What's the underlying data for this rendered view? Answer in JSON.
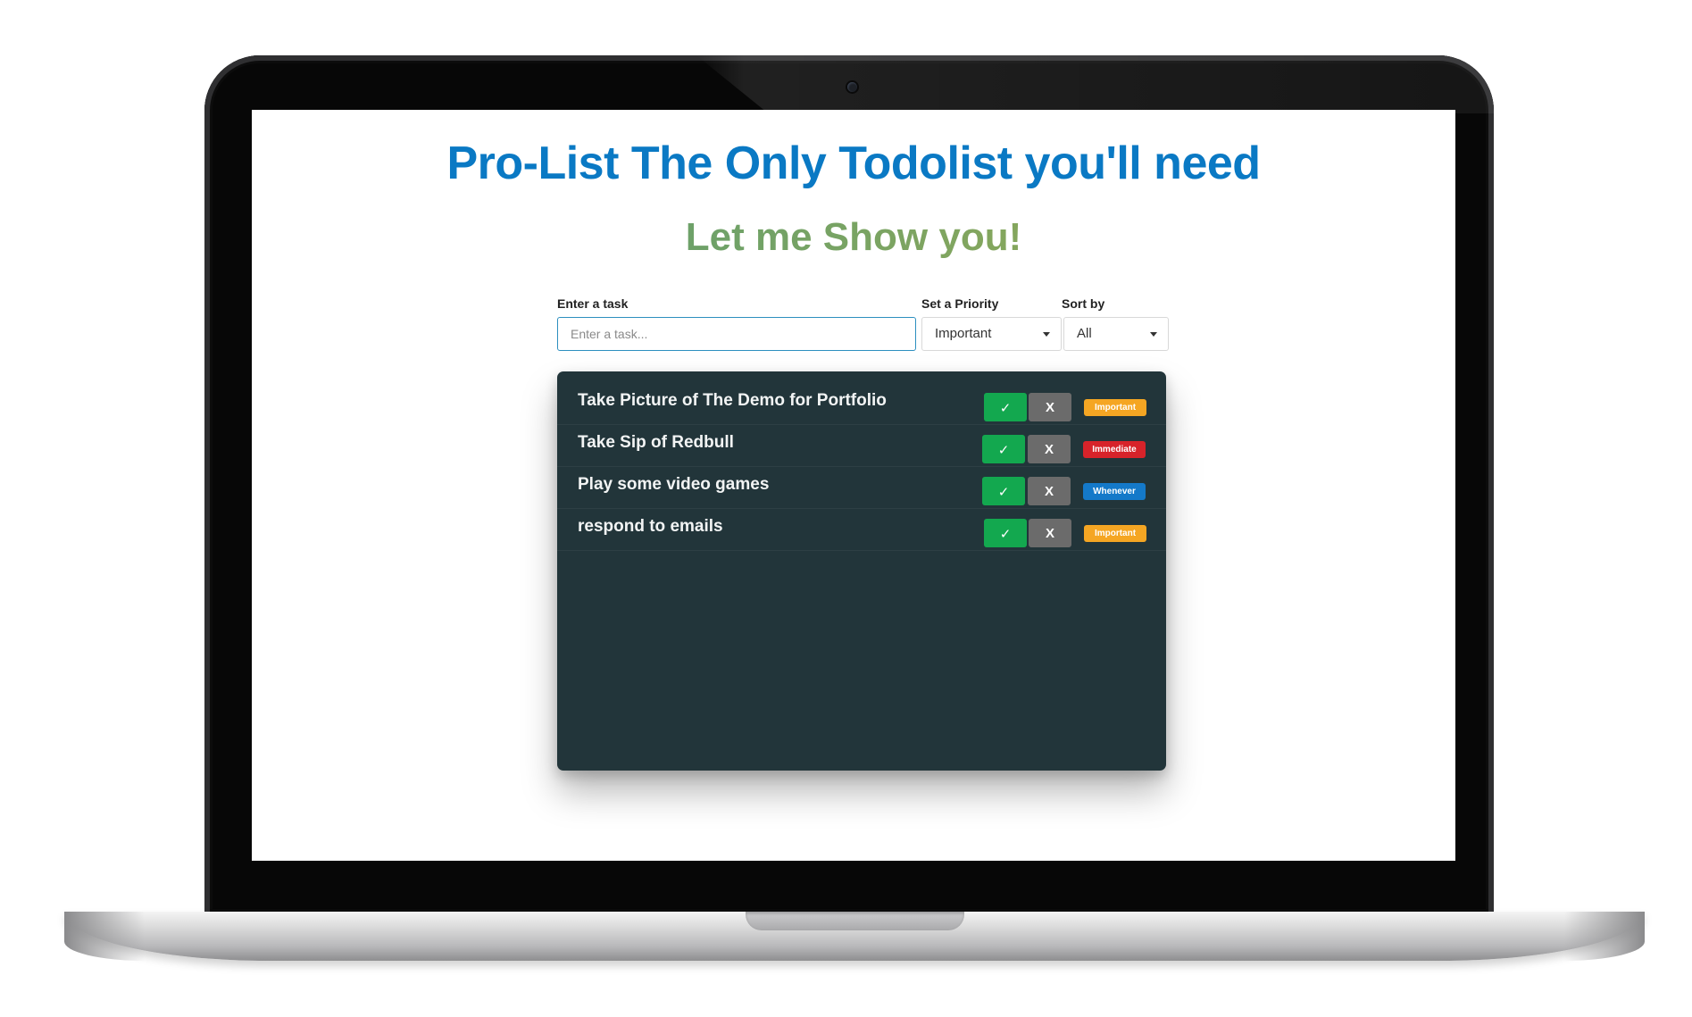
{
  "app": {
    "title": "Pro-List The Only Todolist you'll need",
    "subtitle": "Let me Show you!"
  },
  "form": {
    "task_label": "Enter a task",
    "task_placeholder": "Enter a task...",
    "task_value": "",
    "priority_label": "Set a Priority",
    "priority_selected": "Important",
    "sort_label": "Sort by",
    "sort_selected": "All"
  },
  "tasks": [
    {
      "text": "Take Picture of The Demo for Portfolio",
      "done_label": "✓",
      "delete_label": "X",
      "priority": "Important"
    },
    {
      "text": "Take Sip of Redbull",
      "done_label": "✓",
      "delete_label": "X",
      "priority": "Immediate"
    },
    {
      "text": "Play some video games",
      "done_label": "✓",
      "delete_label": "X",
      "priority": "Whenever"
    },
    {
      "text": "respond to emails",
      "done_label": "✓",
      "delete_label": "X",
      "priority": "Important"
    }
  ],
  "colors": {
    "title": "#0a79c4",
    "subtitle_start": "#4f9a78",
    "subtitle_end": "#a3ad4e",
    "panel": "#22353a",
    "done_button": "#13a84f",
    "delete_button": "#6b6b6b",
    "priority_important": "#f5a623",
    "priority_immediate": "#d7232a",
    "priority_whenever": "#1479c9"
  },
  "icons": {
    "done": "checkmark-icon",
    "dropdown": "caret-down-icon",
    "camera": "webcam"
  }
}
